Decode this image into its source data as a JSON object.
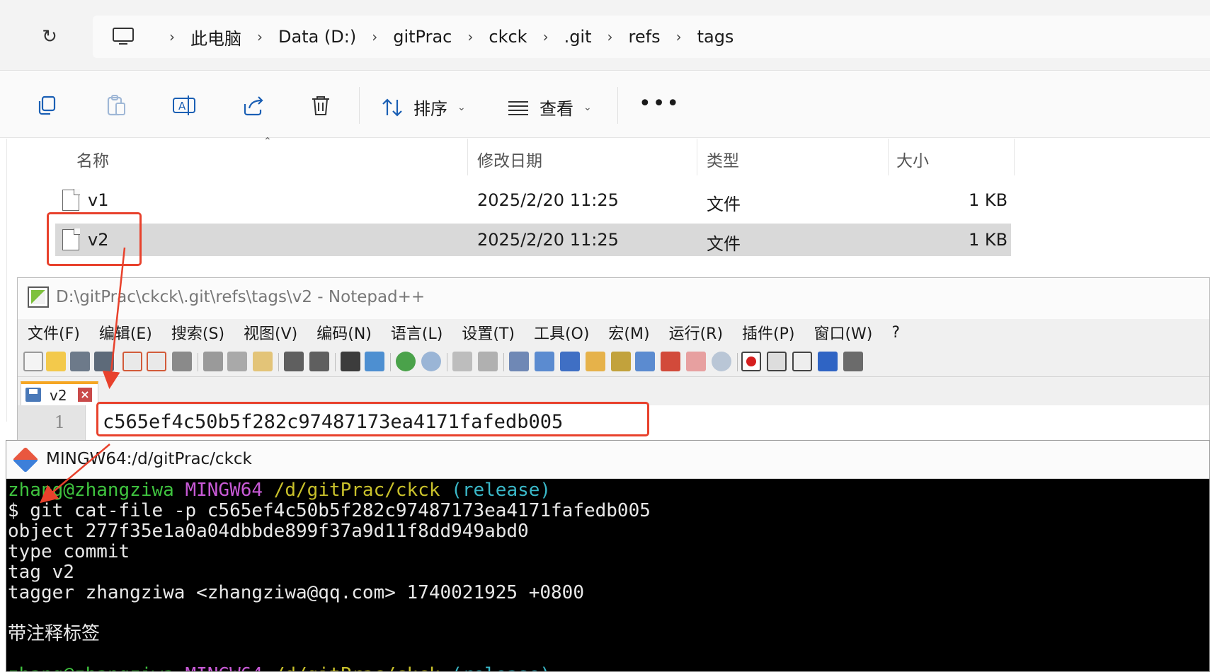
{
  "explorer": {
    "breadcrumbs": [
      "此电脑",
      "Data (D:)",
      "gitPrac",
      "ckck",
      ".git",
      "refs",
      "tags"
    ],
    "toolbar": {
      "sort_label": "排序",
      "view_label": "查看",
      "more_label": "•••"
    },
    "columns": {
      "name": "名称",
      "modified": "修改日期",
      "type": "类型",
      "size": "大小"
    },
    "files": [
      {
        "name": "v1",
        "modified": "2025/2/20 11:25",
        "type": "文件",
        "size": "1 KB"
      },
      {
        "name": "v2",
        "modified": "2025/2/20 11:25",
        "type": "文件",
        "size": "1 KB"
      }
    ]
  },
  "notepad": {
    "title": "D:\\gitPrac\\ckck\\.git\\refs\\tags\\v2 - Notepad++",
    "menu": [
      "文件(F)",
      "编辑(E)",
      "搜索(S)",
      "视图(V)",
      "编码(N)",
      "语言(L)",
      "设置(T)",
      "工具(O)",
      "宏(M)",
      "运行(R)",
      "插件(P)",
      "窗口(W)",
      "?"
    ],
    "tab_label": "v2",
    "line_number": "1",
    "line_text": "c565ef4c50b5f282c97487173ea4171fafedb005"
  },
  "terminal": {
    "title": "MINGW64:/d/gitPrac/ckck",
    "prompt_user": "zhang@zhangziwa",
    "prompt_env": "MINGW64",
    "prompt_path": "/d/gitPrac/ckck",
    "prompt_branch": "(release)",
    "command": "$ git cat-file -p c565ef4c50b5f282c97487173ea4171fafedb005",
    "output": [
      "object 277f35e1a0a04dbbde899f37a9d11f8dd949abd0",
      "type commit",
      "tag v2",
      "tagger zhangziwa <zhangziwa@qq.com> 1740021925 +0800",
      "",
      "带注释标签",
      ""
    ]
  },
  "colors": {
    "annotation_red": "#e8412c",
    "prompt_green": "#3fc43f",
    "prompt_magenta": "#c85ad6",
    "prompt_yellow": "#c9c12b",
    "prompt_cyan": "#3ab8c8"
  }
}
